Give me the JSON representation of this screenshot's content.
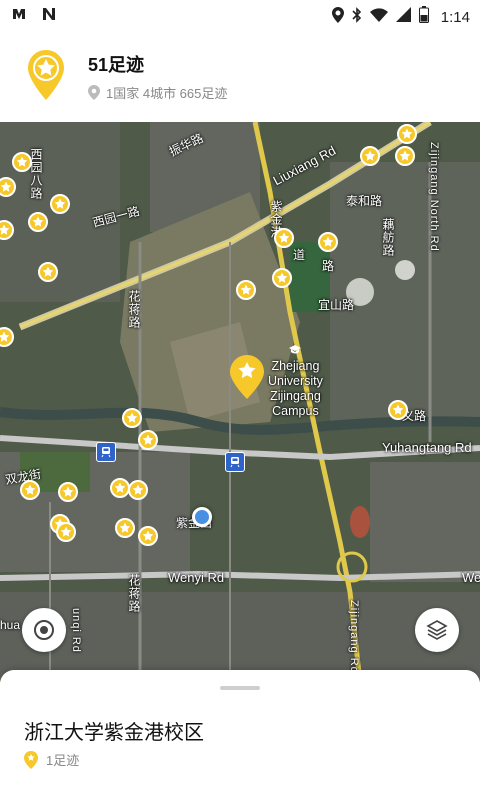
{
  "status_bar": {
    "time": "1:14",
    "left_icons": [
      "app-notification-icon",
      "n-notification-icon"
    ],
    "right_icons": [
      "location-icon",
      "bluetooth-icon",
      "wifi-icon",
      "signal-icon",
      "battery-icon"
    ]
  },
  "header": {
    "title": "51足迹",
    "stats": "1国家  4城市  665足迹",
    "accent": "#f7c82a"
  },
  "map": {
    "labels": {
      "zhenhua": "振华路",
      "xixi8": "西园八路",
      "xiyuan1": "西园一路",
      "liuxiang": "Liuxiang Rd",
      "zijin_gang": "紫金港",
      "zijin_dao": "道",
      "taihe": "泰和路",
      "ouan": "藕舫路",
      "zijingang_north": "Zijingang North Rd",
      "yishan": "宜山路",
      "jiang_rd": "路",
      "huajiang": "花蒋路",
      "campus": "Zhejiang\nUniversity\nZijingang\nCampus",
      "yuhangtang": "Yuhangtang Rd",
      "shuanglong": "双龙街",
      "zijingwei": "紫金西",
      "wenyi": "Wenyi Rd",
      "wenyi_right": "We",
      "huajiang2": "花蒋路",
      "sanjiang": "三剑路",
      "gongyi": "义路",
      "zijingang_rd": "Zijingang Rd",
      "shua": "hua",
      "nqi": "unqi Rd"
    }
  },
  "sheet": {
    "place_name": "浙江大学紫金港校区",
    "footprint_count": "1足迹"
  }
}
